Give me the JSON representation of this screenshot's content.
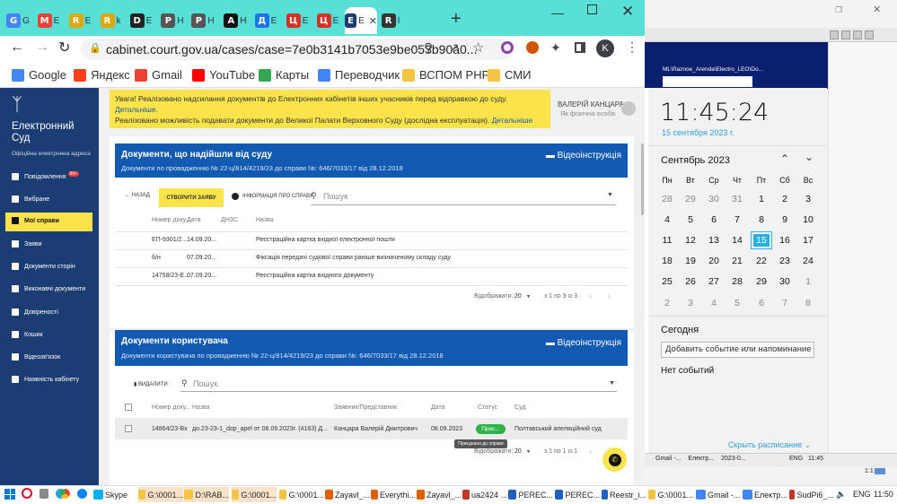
{
  "browser": {
    "tabs": [
      {
        "icon": "G",
        "color": "#4285f4",
        "label": "G"
      },
      {
        "icon": "M",
        "color": "#ea4335",
        "label": "E"
      },
      {
        "icon": "R",
        "color": "#e0a800",
        "label": "E"
      },
      {
        "icon": "R",
        "color": "#e0a800",
        "label": "k"
      },
      {
        "icon": "D",
        "color": "#222222",
        "label": "E"
      },
      {
        "icon": "P",
        "color": "#555555",
        "label": "H"
      },
      {
        "icon": "P",
        "color": "#555555",
        "label": "H"
      },
      {
        "icon": "A",
        "color": "#111111",
        "label": "H"
      },
      {
        "icon": "Д",
        "color": "#1a73e8",
        "label": "E"
      },
      {
        "icon": "Ц",
        "color": "#d93025",
        "label": "E"
      },
      {
        "icon": "Ц",
        "color": "#d93025",
        "label": "E"
      },
      {
        "icon": "E",
        "color": "#1b3d73",
        "label": "E"
      },
      {
        "icon": "R",
        "color": "#333333",
        "label": "I"
      }
    ],
    "active_tab_label": "E",
    "new_tab": "+",
    "url": "cabinet.court.gov.ua/cases/case=7e0b3141b7053e9be053b90a0...",
    "profile_initial": "K",
    "bookmarks": [
      {
        "label": "Google",
        "color": "#4285f4"
      },
      {
        "label": "Яндекс",
        "color": "#fc3f1d"
      },
      {
        "label": "Gmail",
        "color": "#ea4335"
      },
      {
        "label": "YouTube",
        "color": "#ff0000"
      },
      {
        "label": "Карты",
        "color": "#34a853"
      },
      {
        "label": "Переводчик",
        "color": "#4285f4"
      },
      {
        "label": "ВСПОМ PHP",
        "color": "#f6c445"
      },
      {
        "label": "СМИ",
        "color": "#f6c445"
      }
    ]
  },
  "sidebar": {
    "logo_text": "Електронний Суд",
    "subtitle": "Офіційна електронна адреса",
    "items": [
      {
        "label": "Повідомлення",
        "badge": "99+"
      },
      {
        "label": "Вибране"
      },
      {
        "label": "Мої справи",
        "active": true
      },
      {
        "label": "Заяви"
      },
      {
        "label": "Документи сторін"
      },
      {
        "label": "Виконавчі документи"
      },
      {
        "label": "Довіреності"
      },
      {
        "label": "Кошик"
      },
      {
        "label": "Відеозв'язок"
      },
      {
        "label": "Наявність кабінету"
      }
    ]
  },
  "alert": {
    "line1": "Увага! Реалізовано надсилання документів до Електронних кабінетів інших учасників перед відправкою до суду.",
    "link1": "Детальніше.",
    "line2": "Реалізовано можливість подавати документи до Великої Палати Верховного Суду (дослідна експлуатація).",
    "link2": "Детальніше"
  },
  "user": {
    "name": "ВАЛЕРІЙ КАНЦАРА",
    "role": "Як фізична особа"
  },
  "court_docs": {
    "title": "Документи, що надійшли від суду",
    "subtitle": "Документи по провадженню № 22-ц/814/4219/23 до справи №: 646/7033/17 від 28.12.2018",
    "video": "Відеоінструкція",
    "back": "НАЗАД",
    "create": "СТВОРИТИ ЗАЯВУ",
    "info": "ІНФОРМАЦІЯ ПРО СПРАВУ",
    "search_placeholder": "Пошук",
    "columns": [
      "Номер доку...",
      "Дата",
      "ДНЗС",
      "Назва"
    ],
    "rows": [
      {
        "num": "ЕП-9301/2...",
        "date": "14.09.20...",
        "name": "Реєстраційна картка вхідної електронної пошти"
      },
      {
        "num": "б/н",
        "date": "07.09.20...",
        "name": "Фіксація передачі судової справи раніше визначеному складу суду"
      },
      {
        "num": "14758/23-Е...",
        "date": "07.09.20...",
        "name": "Реєстраційна картка вхідного документу"
      }
    ],
    "pager_label": "Відображати:",
    "per_page": "20",
    "range": "з 1 по 3 із 3"
  },
  "user_docs": {
    "title": "Документи користувача",
    "subtitle": "Документи користувача по провадженню № 22-ц/814/4219/23 до справи №: 646/7033/17 від 28.12.2018",
    "video": "Відеоінструкція",
    "delete": "ВИДАЛИТИ",
    "search_placeholder": "Пошук",
    "columns": [
      "Номер доку...",
      "Назва",
      "Заявник/Представник",
      "Дата",
      "Статус",
      "Суд"
    ],
    "rows": [
      {
        "num": "14864/23-Вх",
        "name": "до.23-23-1_dop_apel от 08.09.2023г. (4163) Д...",
        "applicant": "Канцара Валерій Дмитрович",
        "date": "08.09.2023",
        "status": "Прис...",
        "court": "Полтавський апеляційний суд"
      }
    ],
    "tooltip": "Приєднано до справи",
    "pager_label": "Відображати:",
    "per_page": "20",
    "range": "з 1 по 1 із 1"
  },
  "calendar": {
    "win_path": "ML\\Raznoe_Arenda\\Electro_LEO\\Do...",
    "time": "11:45:24",
    "date": "15 сентября 2023 г.",
    "month": "Сентябрь 2023",
    "weekdays": [
      "Пн",
      "Вт",
      "Ср",
      "Чт",
      "Пт",
      "Сб",
      "Вс"
    ],
    "weeks": [
      [
        {
          "d": "28",
          "dim": true
        },
        {
          "d": "29",
          "dim": true
        },
        {
          "d": "30",
          "dim": true
        },
        {
          "d": "31",
          "dim": true
        },
        {
          "d": "1"
        },
        {
          "d": "2"
        },
        {
          "d": "3"
        }
      ],
      [
        {
          "d": "4"
        },
        {
          "d": "5"
        },
        {
          "d": "6"
        },
        {
          "d": "7"
        },
        {
          "d": "8"
        },
        {
          "d": "9"
        },
        {
          "d": "10"
        }
      ],
      [
        {
          "d": "11"
        },
        {
          "d": "12"
        },
        {
          "d": "13"
        },
        {
          "d": "14"
        },
        {
          "d": "15",
          "today": true
        },
        {
          "d": "16"
        },
        {
          "d": "17"
        }
      ],
      [
        {
          "d": "18"
        },
        {
          "d": "19"
        },
        {
          "d": "20"
        },
        {
          "d": "21"
        },
        {
          "d": "22"
        },
        {
          "d": "23"
        },
        {
          "d": "24"
        }
      ],
      [
        {
          "d": "25"
        },
        {
          "d": "26"
        },
        {
          "d": "27"
        },
        {
          "d": "28"
        },
        {
          "d": "29"
        },
        {
          "d": "30"
        },
        {
          "d": "1",
          "dim": true
        }
      ],
      [
        {
          "d": "2",
          "dim": true
        },
        {
          "d": "3",
          "dim": true
        },
        {
          "d": "4",
          "dim": true
        },
        {
          "d": "5",
          "dim": true
        },
        {
          "d": "6",
          "dim": true
        },
        {
          "d": "7",
          "dim": true
        },
        {
          "d": "8",
          "dim": true
        }
      ]
    ],
    "today_label": "Сегодня",
    "add_event": "Добавить событие или напоминание",
    "no_events": "Нет событий",
    "hide_schedule": "Скрыть расписание"
  },
  "mini_taskbar": {
    "items": [
      "Gmail -...",
      "Електр...",
      "2023-0..."
    ],
    "lang": "ENG",
    "time": "11:45",
    "ratio": "1:1"
  },
  "taskbar": {
    "items": [
      {
        "label": "Skype",
        "color": "#00aff0"
      },
      {
        "label": "G:\\0001...",
        "color": "#f6c445"
      },
      {
        "label": "D:\\RAB...",
        "color": "#f6c445"
      },
      {
        "label": "G:\\0001...",
        "color": "#f6c445"
      },
      {
        "label": "G:\\0001...",
        "color": "#f6c445"
      },
      {
        "label": "Zayavl_...",
        "color": "#e06000"
      },
      {
        "label": "Everythi...",
        "color": "#e06000"
      },
      {
        "label": "Zayavl_...",
        "color": "#e06000"
      },
      {
        "label": "ua2424 ...",
        "color": "#c0392b"
      },
      {
        "label": "PEREC...",
        "color": "#1e5fbf"
      },
      {
        "label": "PERЕС...",
        "color": "#1e5fbf"
      },
      {
        "label": "Reestr_i...",
        "color": "#1e5fbf"
      },
      {
        "label": "G:\\0001...",
        "color": "#f6c445"
      },
      {
        "label": "Gmail -...",
        "color": "#4285f4"
      },
      {
        "label": "Електр...",
        "color": "#4285f4"
      },
      {
        "label": "SudPi6_...",
        "color": "#c0392b"
      }
    ],
    "lang": "ENG",
    "time": "11:50"
  }
}
